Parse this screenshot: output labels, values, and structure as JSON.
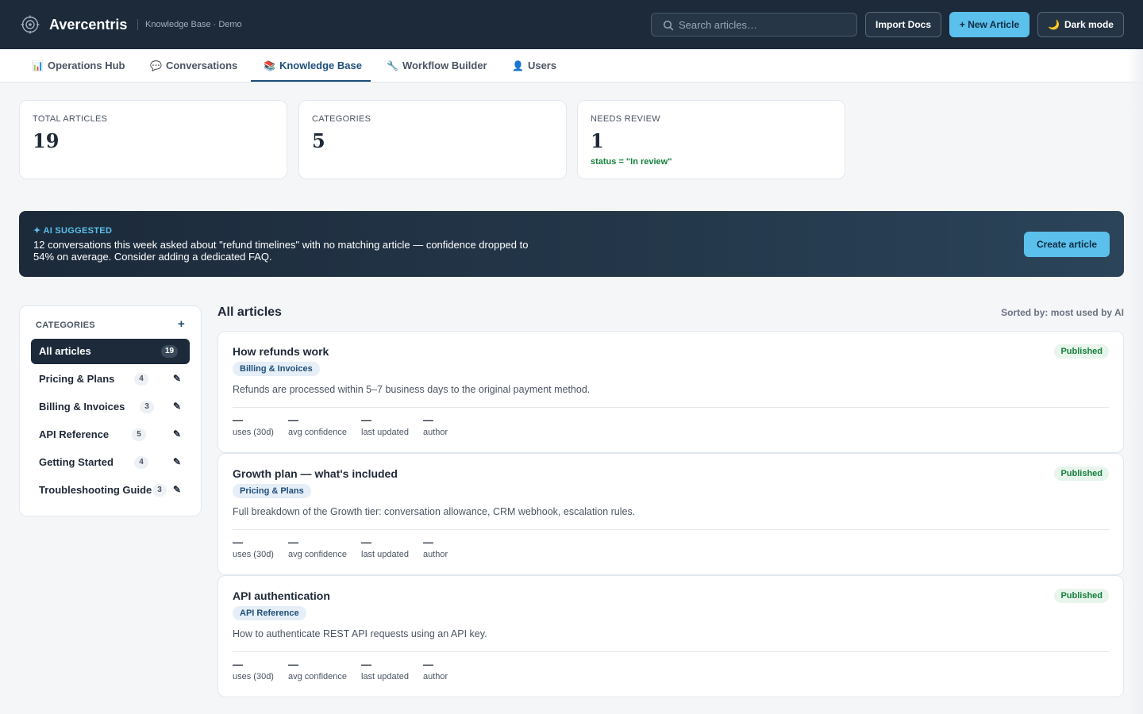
{
  "app": {
    "brand": "Avercentris",
    "subtitle": "Knowledge Base · Demo",
    "icons": {
      "logo": "target-icon",
      "search": "search-icon",
      "dark_mode": "moon-icon"
    }
  },
  "header": {
    "search_placeholder": "Search articles…",
    "import_label": "Import Docs",
    "new_article_label": "+ New Article",
    "dark_mode_label": "Dark mode"
  },
  "tabs": [
    {
      "label": "Operations Hub",
      "icon": "📊",
      "icon_name": "bar-chart-icon",
      "active": false
    },
    {
      "label": "Conversations",
      "icon": "💬",
      "icon_name": "speech-bubble-icon",
      "active": false
    },
    {
      "label": "Knowledge Base",
      "icon": "📚",
      "icon_name": "books-icon",
      "active": true
    },
    {
      "label": "Workflow Builder",
      "icon": "🔧",
      "icon_name": "wrench-icon",
      "active": false
    },
    {
      "label": "Users",
      "icon": "👤",
      "icon_name": "user-icon",
      "active": false
    }
  ],
  "stats": [
    {
      "label": "TOTAL ARTICLES",
      "value": "19",
      "note": ""
    },
    {
      "label": "CATEGORIES",
      "value": "5",
      "note": ""
    },
    {
      "label": "NEEDS REVIEW",
      "value": "1",
      "note": "status = \"In review\""
    }
  ],
  "banner": {
    "tag": "✦ AI SUGGESTED",
    "text": "12 conversations this week asked about \"refund timelines\" with no matching article — confidence dropped to 54% on average. Consider adding a dedicated FAQ.",
    "button_label": "Create article"
  },
  "sidebar": {
    "title": "CATEGORIES",
    "add_label": "+",
    "edit_icon": "✎",
    "items": [
      {
        "label": "All articles",
        "count": "19",
        "active": true
      },
      {
        "label": "Pricing & Plans",
        "count": "4",
        "active": false
      },
      {
        "label": "Billing & Invoices",
        "count": "3",
        "active": false
      },
      {
        "label": "API Reference",
        "count": "5",
        "active": false
      },
      {
        "label": "Getting Started",
        "count": "4",
        "active": false
      },
      {
        "label": "Troubleshooting Guide",
        "count": "3",
        "active": false
      }
    ]
  },
  "articles_section": {
    "title": "All articles",
    "sorted_label": "Sorted by: most used by AI"
  },
  "articles": [
    {
      "title": "How refunds work",
      "category": "Billing & Invoices",
      "status": "Published",
      "description": "Refunds are processed within 5–7 business days to the original payment method.",
      "metrics": [
        {
          "value": "—",
          "label": "uses (30d)"
        },
        {
          "value": "—",
          "label": "avg confidence"
        },
        {
          "value": "—",
          "label": "last updated"
        },
        {
          "value": "—",
          "label": "author"
        }
      ]
    },
    {
      "title": "Growth plan — what's included",
      "category": "Pricing & Plans",
      "status": "Published",
      "description": "Full breakdown of the Growth tier: conversation allowance, CRM webhook, escalation rules.",
      "metrics": [
        {
          "value": "—",
          "label": "uses (30d)"
        },
        {
          "value": "—",
          "label": "avg confidence"
        },
        {
          "value": "—",
          "label": "last updated"
        },
        {
          "value": "—",
          "label": "author"
        }
      ]
    },
    {
      "title": "API authentication",
      "category": "API Reference",
      "status": "Published",
      "description": "How to authenticate REST API requests using an API key.",
      "metrics": [
        {
          "value": "—",
          "label": "uses (30d)"
        },
        {
          "value": "—",
          "label": "avg confidence"
        },
        {
          "value": "—",
          "label": "last updated"
        },
        {
          "value": "—",
          "label": "author"
        }
      ]
    }
  ],
  "colors": {
    "header_bg": "#1c2a3a",
    "accent": "#5bc0eb",
    "primary": "#1e4f7a",
    "published_text": "#15803d",
    "published_bg": "#e8f5ec"
  }
}
